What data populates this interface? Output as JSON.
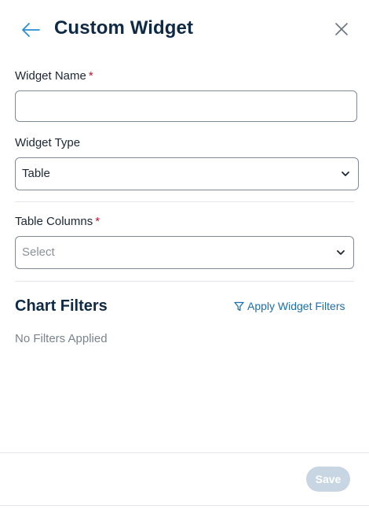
{
  "header": {
    "title": "Custom Widget",
    "back_icon": "arrow-left-icon",
    "close_icon": "close-icon"
  },
  "form": {
    "widget_name": {
      "label": "Widget Name",
      "required_mark": "*",
      "value": "",
      "placeholder": ""
    },
    "widget_type": {
      "label": "Widget Type",
      "value": "Table"
    },
    "table_columns": {
      "label": "Table Columns",
      "required_mark": "*",
      "placeholder": "Select"
    }
  },
  "filters": {
    "title": "Chart Filters",
    "apply_label": "Apply Widget Filters",
    "empty_text": "No Filters Applied"
  },
  "footer": {
    "save_label": "Save"
  },
  "colors": {
    "accent": "#1a6fb0",
    "required": "#c8102e",
    "save_disabled": "#c8d6e3"
  }
}
